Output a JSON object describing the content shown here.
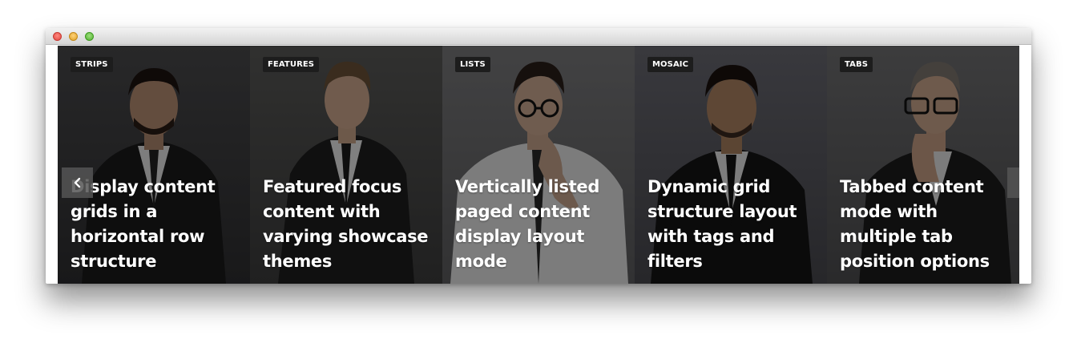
{
  "window": {
    "controls": [
      "close-icon",
      "minimize-icon",
      "zoom-icon"
    ]
  },
  "slider": {
    "prev_icon": "chevron-left-icon",
    "next_icon": "chevron-right-icon",
    "slides": [
      {
        "tag": "STRIPS",
        "caption": "Display content grids in a horizontal row structure",
        "bg": "#3a3a3c"
      },
      {
        "tag": "FEATURES",
        "caption": "Featured focus content with varying showcase themes",
        "bg": "#4a4a4a"
      },
      {
        "tag": "LISTS",
        "caption": "Vertically listed paged content display layout mode",
        "bg": "#6a6a6c"
      },
      {
        "tag": "MOSAIC",
        "caption": "Dynamic grid structure layout with tags and filters",
        "bg": "#52525a"
      },
      {
        "tag": "TABS",
        "caption": "Tabbed content mode with multiple tab position options",
        "bg": "#5a5a5c"
      }
    ]
  }
}
